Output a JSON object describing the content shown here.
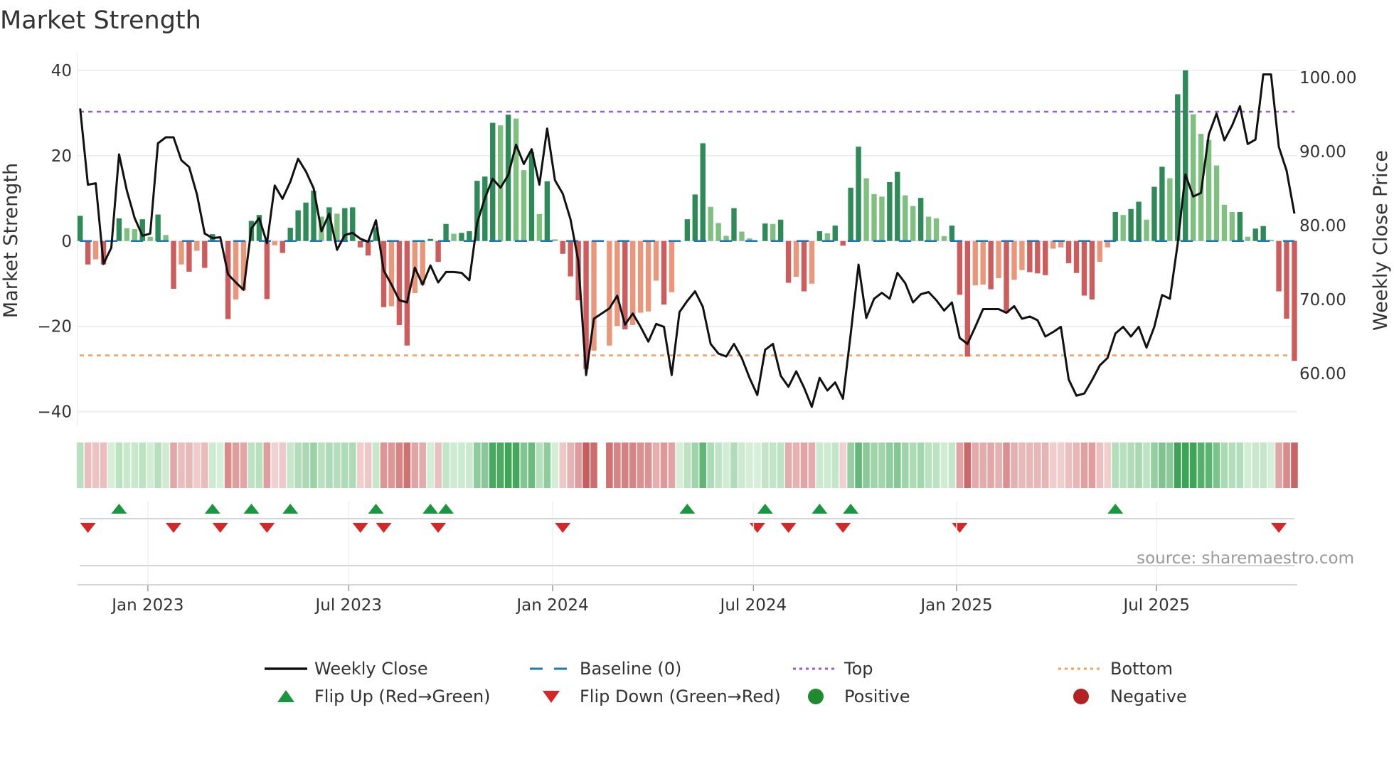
{
  "title": "Market Strength",
  "source": "source: sharemaestro.com",
  "chart_data": {
    "type": "bar",
    "title": "Market Strength",
    "ylabel": "Market Strength",
    "y2label": "Weekly Close Price",
    "ylim": [
      -40,
      40
    ],
    "y2lim": [
      60,
      100
    ],
    "yticks": [
      "40",
      "20",
      "0",
      "−20",
      "−40"
    ],
    "ytick_values": [
      40,
      20,
      0,
      -20,
      -40
    ],
    "y2ticks": [
      "100.00",
      "90.00",
      "80.00",
      "70.00",
      "60.00"
    ],
    "y2tick_values": [
      100,
      90,
      80,
      70,
      60
    ],
    "top_level": 30.3,
    "bottom_level": -26.8,
    "baseline": 0,
    "weeks": 157,
    "xticks": [
      {
        "label": "Jan 2023",
        "week": 8.7
      },
      {
        "label": "Jul 2023",
        "week": 34.5
      },
      {
        "label": "Jan 2024",
        "week": 60.7
      },
      {
        "label": "Jul 2024",
        "week": 86.5
      },
      {
        "label": "Jan 2025",
        "week": 112.6
      },
      {
        "label": "Jul 2025",
        "week": 138.3
      }
    ],
    "strength": [
      5.9,
      -5.5,
      -4.3,
      -5.5,
      0,
      5.3,
      3,
      2.8,
      5.1,
      1,
      6.2,
      1.4,
      -11.2,
      -5.5,
      -7.2,
      -2.3,
      -6.3,
      1.6,
      0,
      -18.3,
      -13.7,
      -11.6,
      4.7,
      6.1,
      -13.6,
      -1,
      -2.8,
      3.1,
      7.2,
      9,
      11.8,
      5.7,
      7.9,
      6.4,
      7.7,
      7.9,
      -1.5,
      -3.4,
      3.2,
      -15.5,
      -15.3,
      -19.7,
      -24.5,
      -12.2,
      -10.3,
      0.5,
      -4.9,
      4,
      1.7,
      1.9,
      2.3,
      14.1,
      15.1,
      27.7,
      27.1,
      29.6,
      28.7,
      16.6,
      20.8,
      6.3,
      14,
      0.4,
      -3,
      -8.3,
      -13.9,
      -30,
      -25.7,
      null,
      -24.5,
      -19.9,
      -20.7,
      -19.7,
      -16.8,
      -16.5,
      -9.3,
      -14.9,
      -12,
      0,
      5.1,
      10.9,
      22.9,
      8,
      4.2,
      1.2,
      7.7,
      2.2,
      0.6,
      0,
      4.1,
      4,
      5,
      -9.8,
      -8.4,
      -11.8,
      -10,
      2.3,
      1.8,
      3.6,
      -1.1,
      12.5,
      22.1,
      14.7,
      11,
      10.4,
      13.8,
      16.2,
      10.7,
      8.2,
      10.1,
      5.7,
      5.3,
      1.1,
      3.6,
      -12.6,
      -27.1,
      -10.4,
      -10.2,
      -11.3,
      -8.7,
      -16.9,
      -9.1,
      -6.8,
      -7.3,
      -7.6,
      -8,
      -1.8,
      -1.5,
      -5.2,
      -7.5,
      -12.8,
      -13.7,
      -4.9,
      -1.5,
      6.8,
      6.1,
      7.5,
      9.2,
      5,
      12.7,
      17.4,
      14.7,
      34.4,
      40,
      29.7,
      25.1,
      23.7,
      17.7,
      8.5,
      6.8,
      6.8,
      1,
      2.9,
      3.5,
      0.3,
      -11.8,
      -18.2,
      -28.1
    ],
    "weekly_close": [
      95.8,
      85.5,
      85.7,
      74.8,
      77,
      89.6,
      84.7,
      81,
      78.6,
      78.9,
      91.1,
      91.9,
      91.9,
      88.8,
      87.9,
      84.2,
      78.9,
      78.3,
      78.4,
      73.4,
      72.3,
      71.3,
      79.6,
      81,
      77.6,
      85.4,
      83.6,
      85.9,
      89,
      87.3,
      85,
      79.2,
      81.6,
      76.7,
      78.7,
      79,
      78.2,
      77.8,
      80.7,
      73.9,
      72,
      69.9,
      69.6,
      74.3,
      72,
      74.6,
      72.3,
      73.7,
      73.7,
      73.6,
      72.6,
      80.3,
      83.7,
      86.3,
      85.1,
      86.8,
      90.9,
      88.3,
      90.3,
      85.5,
      93.1,
      86.1,
      84.3,
      80.8,
      75.2,
      59.8,
      67.4,
      68.1,
      68.8,
      70.5,
      66.6,
      68.1,
      66.3,
      64.3,
      66.7,
      66.3,
      59.8,
      68.3,
      69.8,
      71.1,
      69,
      64,
      62.7,
      62.3,
      64,
      62.1,
      59.4,
      57.1,
      63.2,
      64,
      59.7,
      58.2,
      60.3,
      58.1,
      55.5,
      59.4,
      57.7,
      58.8,
      56.6,
      65.4,
      74.7,
      67.5,
      70.1,
      70.9,
      70.1,
      73.6,
      72.2,
      69.6,
      70.7,
      71,
      69.9,
      68.5,
      69.6,
      64.8,
      64,
      66.3,
      68.7,
      68.7,
      68.7,
      68.2,
      69.1,
      67.4,
      67.7,
      67.2,
      65,
      65.6,
      66.3,
      59.2,
      57,
      57.3,
      59.1,
      61.1,
      62.1,
      65.4,
      66.3,
      65,
      66.3,
      63.5,
      66.3,
      70.6,
      70.1,
      77.5,
      86.9,
      83.9,
      84.4,
      92.3,
      95.1,
      91.5,
      93.5,
      96.1,
      91,
      91.6,
      100.4,
      100.4,
      90.6,
      87.4,
      81.6
    ],
    "flip_up_weeks": [
      5,
      17,
      22,
      27,
      38,
      45,
      47,
      78,
      88,
      95,
      99,
      133
    ],
    "flip_down_weeks": [
      1,
      12,
      18,
      24,
      36,
      39,
      46,
      62,
      87,
      91,
      98,
      113,
      154
    ],
    "colors": {
      "pos_strong": "#2e8b57",
      "pos_weak": "#7fbf7f",
      "neg_strong": "#cd5c5c",
      "neg_weak": "#e9967a",
      "line": "#111111",
      "baseline": "#1f77b4",
      "top": "#9b59d6",
      "bottom": "#f0a060",
      "flip_up": "#1a9641",
      "flip_down": "#d62728"
    },
    "legend": {
      "placement": "bottom",
      "items": [
        {
          "label": "Weekly Close",
          "kind": "line"
        },
        {
          "label": "Baseline (0)",
          "kind": "dash"
        },
        {
          "label": "Top",
          "kind": "dot-top"
        },
        {
          "label": "Bottom",
          "kind": "dot-bottom"
        },
        {
          "label": "Flip Up (Red→Green)",
          "kind": "up"
        },
        {
          "label": "Flip Down (Green→Red)",
          "kind": "down"
        },
        {
          "label": "Positive",
          "kind": "pos"
        },
        {
          "label": "Negative",
          "kind": "neg"
        }
      ]
    }
  }
}
